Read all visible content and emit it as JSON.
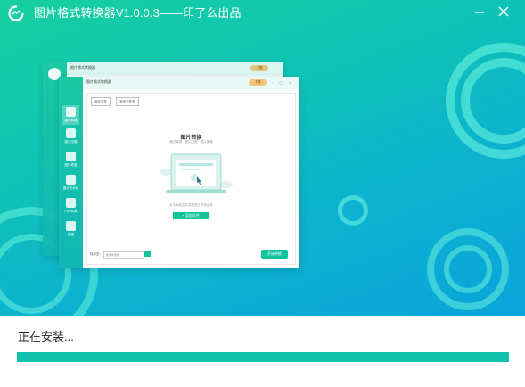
{
  "window": {
    "title": "图片格式转换器V1.0.0.3——印了么出品",
    "minimize_icon": "minimize-icon",
    "close_icon": "close-icon"
  },
  "colors": {
    "accent": "#11c2ad",
    "hero_top": "#17cfa1",
    "hero_bottom": "#0aa4da"
  },
  "illustration": {
    "app_title": "图片格式转换器",
    "badge": "下载",
    "sidebar": [
      "图片转换",
      "图片压缩",
      "图片修复",
      "图片去水印",
      "PDF转换",
      "抠图"
    ],
    "tabs": [
      "添加文件",
      "添加文件夹"
    ],
    "heading": "图片转换",
    "subheading": "格式转换 · 图片压缩 · 图片编辑",
    "hint": "点击添加文件或拖拽文件到此处",
    "add_button": "+ 添加文件",
    "save_label": "保存至：",
    "save_path": "原文件目录",
    "start_button": "开始转换"
  },
  "install": {
    "status": "正在安装...",
    "progress": 1.0
  }
}
